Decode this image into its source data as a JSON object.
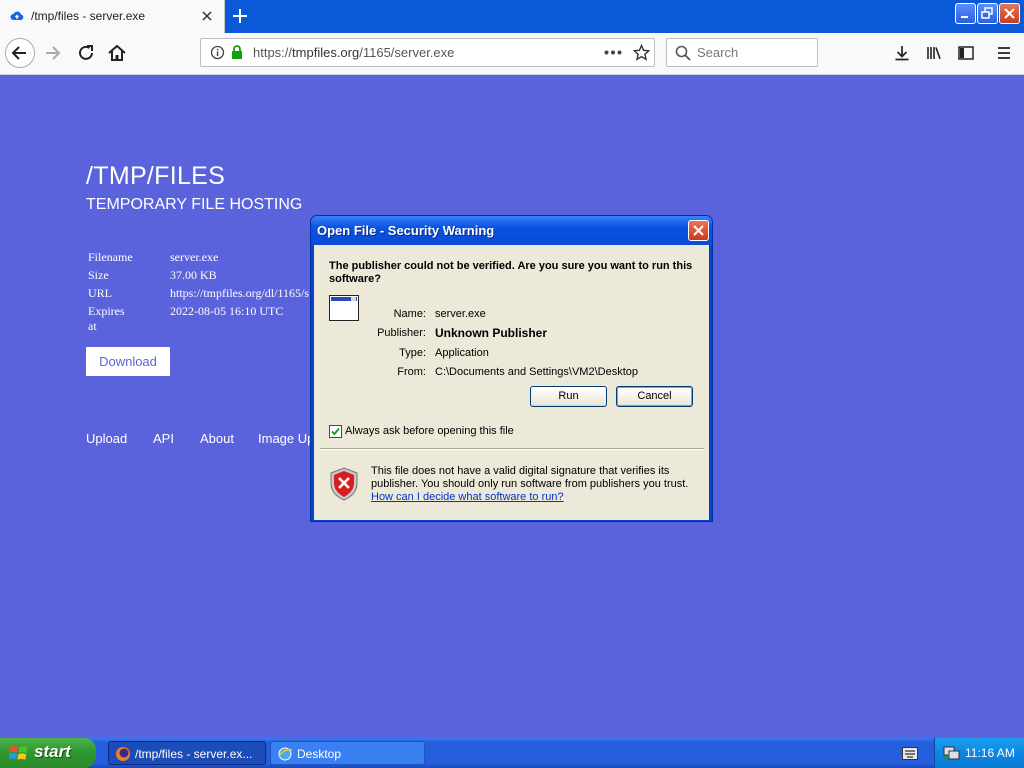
{
  "browser": {
    "tab": {
      "title": "/tmp/files - server.exe"
    },
    "url": {
      "scheme": "https://",
      "host": "tmpfiles.org",
      "path": "/1165/server.exe"
    },
    "search": {
      "placeholder": "Search"
    }
  },
  "page": {
    "title": "/TMP/FILES",
    "subtitle": "TEMPORARY FILE HOSTING",
    "info": [
      {
        "key": "Filename",
        "value": "server.exe"
      },
      {
        "key": "Size",
        "value": "37.00 KB"
      },
      {
        "key": "URL",
        "value": "https://tmpfiles.org/dl/1165/s"
      },
      {
        "key": "Expires at",
        "value": "2022-08-05 16:10 UTC"
      }
    ],
    "download_label": "Download",
    "links": [
      "Upload",
      "API",
      "About",
      "Image Up"
    ]
  },
  "dialog": {
    "title": "Open File - Security Warning",
    "question": "The publisher could not be verified.  Are you sure you want to run this software?",
    "fields": [
      {
        "label": "Name:",
        "value": "server.exe"
      },
      {
        "label": "Publisher:",
        "value": "Unknown Publisher"
      },
      {
        "label": "Type:",
        "value": "Application"
      },
      {
        "label": "From:",
        "value": "C:\\Documents and Settings\\VM2\\Desktop"
      }
    ],
    "run_label": "Run",
    "cancel_label": "Cancel",
    "checkbox_label": "Always ask before opening this file",
    "checkbox_checked": true,
    "warning_text": "This file does not have a valid digital signature that verifies its publisher.  You should only run software from publishers you trust.",
    "warning_link": "How can I decide what software to run?"
  },
  "taskbar": {
    "start_label": "start",
    "items": [
      {
        "label": "/tmp/files - server.ex..."
      },
      {
        "label": "Desktop"
      }
    ],
    "clock": "11:16 AM"
  }
}
